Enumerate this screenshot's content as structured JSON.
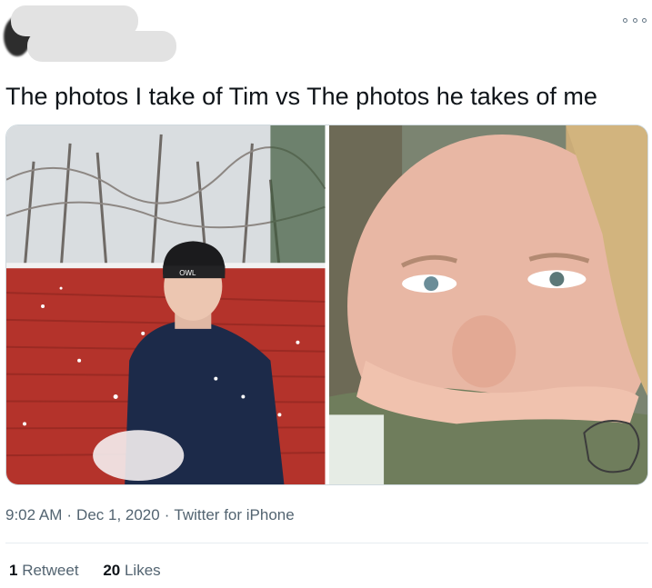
{
  "tweet": {
    "text": "The photos I take of Tim vs The photos he takes of me",
    "media": [
      {
        "icon": "photo-man-in-snow",
        "hat_label": "OWL"
      },
      {
        "icon": "photo-selfie-closeup"
      }
    ]
  },
  "meta": {
    "time": "9:02 AM",
    "separator": "·",
    "date": "Dec 1, 2020",
    "source": "Twitter for iPhone"
  },
  "stats": {
    "retweet_count": "1",
    "retweet_label": "Retweet",
    "like_count": "20",
    "like_label": "Likes"
  },
  "colors": {
    "text": "#0f1419",
    "secondary": "#536471",
    "divider": "#e6ecf0"
  }
}
